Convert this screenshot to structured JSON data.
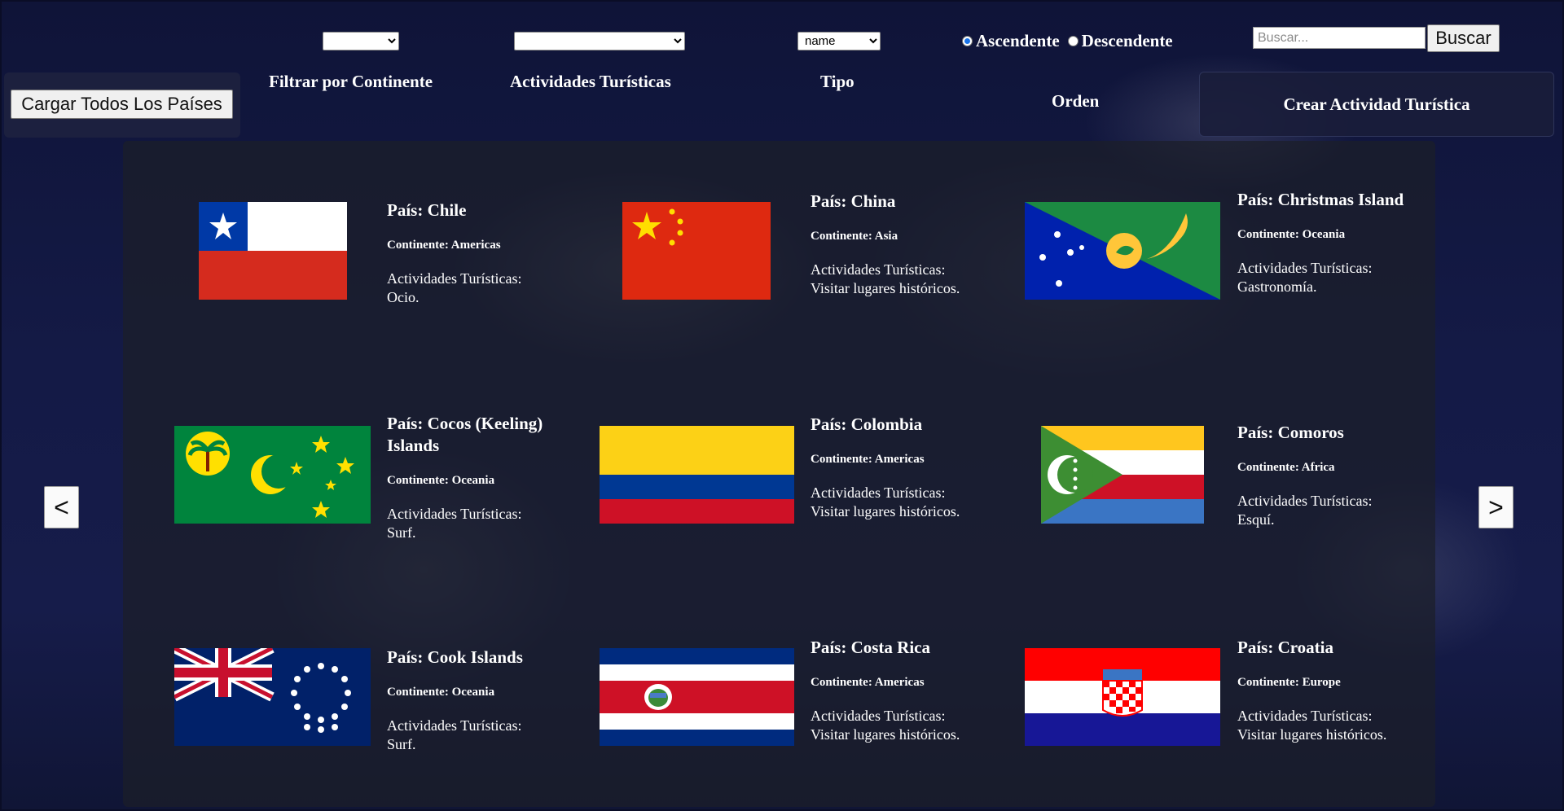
{
  "filters": {
    "continent": {
      "label": "Filtrar por Continente",
      "value": ""
    },
    "activity": {
      "label": "Actividades Turísticas",
      "value": ""
    },
    "type": {
      "label": "Tipo",
      "value": "name"
    },
    "order": {
      "label": "Orden",
      "ascending": "Ascendente",
      "descending": "Descendente",
      "selected": "Ascendente"
    }
  },
  "search": {
    "placeholder": "Buscar...",
    "button": "Buscar"
  },
  "actions": {
    "load_all": "Cargar Todos Los Países",
    "create_activity": "Crear Actividad Turística"
  },
  "nav": {
    "prev": "<",
    "next": ">"
  },
  "countries": [
    {
      "name": "País: Chile",
      "continent": "Continente: Americas",
      "activities": "Actividades Turísticas: Ocio.",
      "flag": "chile-flag"
    },
    {
      "name": "País: China",
      "continent": "Continente: Asia",
      "activities": "Actividades Turísticas: Visitar lugares históricos.",
      "flag": "china-flag"
    },
    {
      "name": "País: Christmas Island",
      "continent": "Continente: Oceania",
      "activities": "Actividades Turísticas: Gastronomía.",
      "flag": "christmas-island-flag"
    },
    {
      "name": "País: Cocos (Keeling) Islands",
      "continent": "Continente: Oceania",
      "activities": "Actividades Turísticas: Surf.",
      "flag": "cocos-islands-flag"
    },
    {
      "name": "País: Colombia",
      "continent": "Continente: Americas",
      "activities": "Actividades Turísticas: Visitar lugares históricos.",
      "flag": "colombia-flag"
    },
    {
      "name": "País: Comoros",
      "continent": "Continente: Africa",
      "activities": "Actividades Turísticas: Esquí.",
      "flag": "comoros-flag"
    },
    {
      "name": "País: Cook Islands",
      "continent": "Continente: Oceania",
      "activities": "Actividades Turísticas: Surf.",
      "flag": "cook-islands-flag"
    },
    {
      "name": "País: Costa Rica",
      "continent": "Continente: Americas",
      "activities": "Actividades Turísticas: Visitar lugares históricos.",
      "flag": "costa-rica-flag"
    },
    {
      "name": "País: Croatia",
      "continent": "Continente: Europe",
      "activities": "Actividades Turísticas: Visitar lugares históricos.",
      "flag": "croatia-flag"
    }
  ]
}
